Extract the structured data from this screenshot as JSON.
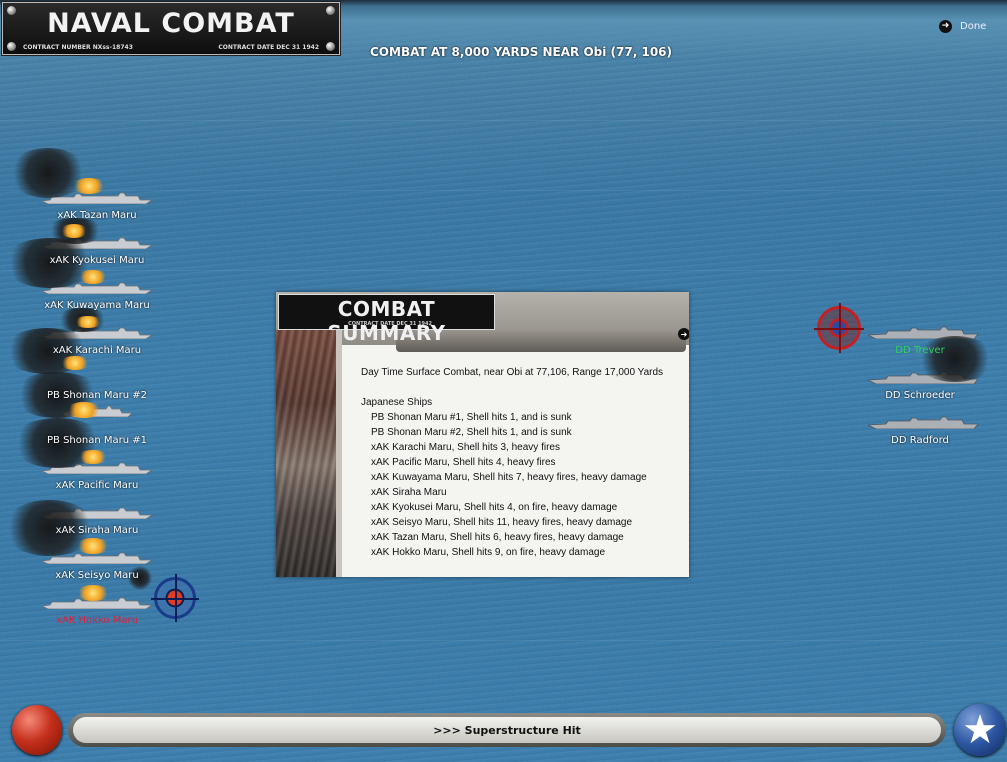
{
  "header": {
    "title": "NAVAL COMBAT",
    "contract_number": "CONTRACT NUMBER  NXss-18743",
    "contract_date": "CONTRACT DATE  DEC 31 1942"
  },
  "combat_title": "COMBAT AT 8,000 YARDS NEAR Obi (77, 106)",
  "done_label": "Done",
  "japanese_ships": [
    "xAK Tazan Maru",
    "xAK Kyokusei Maru",
    "xAK Kuwayama Maru",
    "xAK Karachi Maru",
    "PB Shonan Maru #2",
    "PB Shonan Maru #1",
    "xAK Pacific Maru",
    "xAK Siraha Maru",
    "xAK Seisyo Maru",
    "xAK Hokko Maru"
  ],
  "allied_ships": [
    "DD Trever",
    "DD Schroeder",
    "DD Radford"
  ],
  "summary": {
    "title": "COMBAT SUMMARY",
    "date": "CONTRACT DATE  DEC 31 1942",
    "intro": "Day Time Surface Combat, near Obi at 77,106, Range 17,000 Yards",
    "section": "Japanese Ships",
    "lines": [
      "PB Shonan Maru #1, Shell hits 1, and is sunk",
      "PB Shonan Maru #2, Shell hits 1, and is sunk",
      "xAK Karachi Maru, Shell hits 3,  heavy fires",
      "xAK Pacific Maru, Shell hits 4,  heavy fires",
      "xAK Kuwayama Maru, Shell hits 7,  heavy fires,  heavy damage",
      "xAK Siraha Maru",
      "xAK Kyokusei Maru, Shell hits 4,  on fire,  heavy damage",
      "xAK Seisyo Maru, Shell hits 11,  heavy fires,  heavy damage",
      "xAK Tazan Maru, Shell hits 6,  heavy fires,  heavy damage",
      "xAK Hokko Maru, Shell hits 9,  on fire,  heavy damage"
    ]
  },
  "status_message": ">>> Superstructure Hit",
  "colors": {
    "selected_enemy": "#e0203a",
    "selected_allied": "#2ed15a",
    "ocean": "#3d7eac"
  }
}
